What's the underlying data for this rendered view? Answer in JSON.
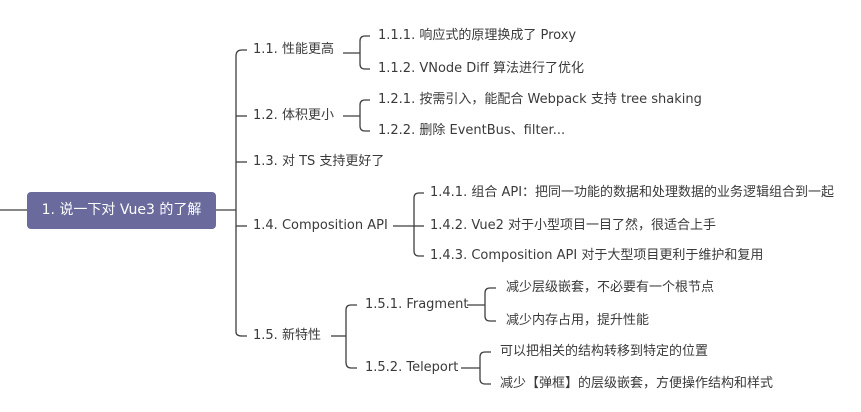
{
  "colors": {
    "root_bg": "#6a6b9c",
    "root_text": "#ffffff",
    "line": "#3f3f3f",
    "text": "#3a3a3a"
  },
  "root": {
    "label": "1. 说一下对 Vue3 的了解"
  },
  "n1_1": {
    "label": "1.1. 性能更高"
  },
  "n1_1_1": {
    "label": "1.1.1. 响应式的原理换成了 Proxy"
  },
  "n1_1_2": {
    "label": "1.1.2. VNode Diff 算法进行了优化"
  },
  "n1_2": {
    "label": "1.2. 体积更小"
  },
  "n1_2_1": {
    "label": "1.2.1. 按需引入，能配合 Webpack 支持 tree shaking"
  },
  "n1_2_2": {
    "label": "1.2.2. 删除 EventBus、filter..."
  },
  "n1_3": {
    "label": "1.3. 对 TS 支持更好了"
  },
  "n1_4": {
    "label": "1.4. Composition API"
  },
  "n1_4_1": {
    "label": "1.4.1. 组合 API：把同一功能的数据和处理数据的业务逻辑组合到一起"
  },
  "n1_4_2": {
    "label": "1.4.2. Vue2 对于小型项目一目了然，很适合上手"
  },
  "n1_4_3": {
    "label": "1.4.3. Composition API 对于大型项目更利于维护和复用"
  },
  "n1_5": {
    "label": "1.5. 新特性"
  },
  "n1_5_1": {
    "label": "1.5.1. Fragment"
  },
  "n1_5_1_a": {
    "label": "减少层级嵌套，不必要有一个根节点"
  },
  "n1_5_1_b": {
    "label": "减少内存占用，提升性能"
  },
  "n1_5_2": {
    "label": "1.5.2. Teleport"
  },
  "n1_5_2_a": {
    "label": "可以把相关的结构转移到特定的位置"
  },
  "n1_5_2_b": {
    "label": "减少【弹框】的层级嵌套，方便操作结构和样式"
  }
}
